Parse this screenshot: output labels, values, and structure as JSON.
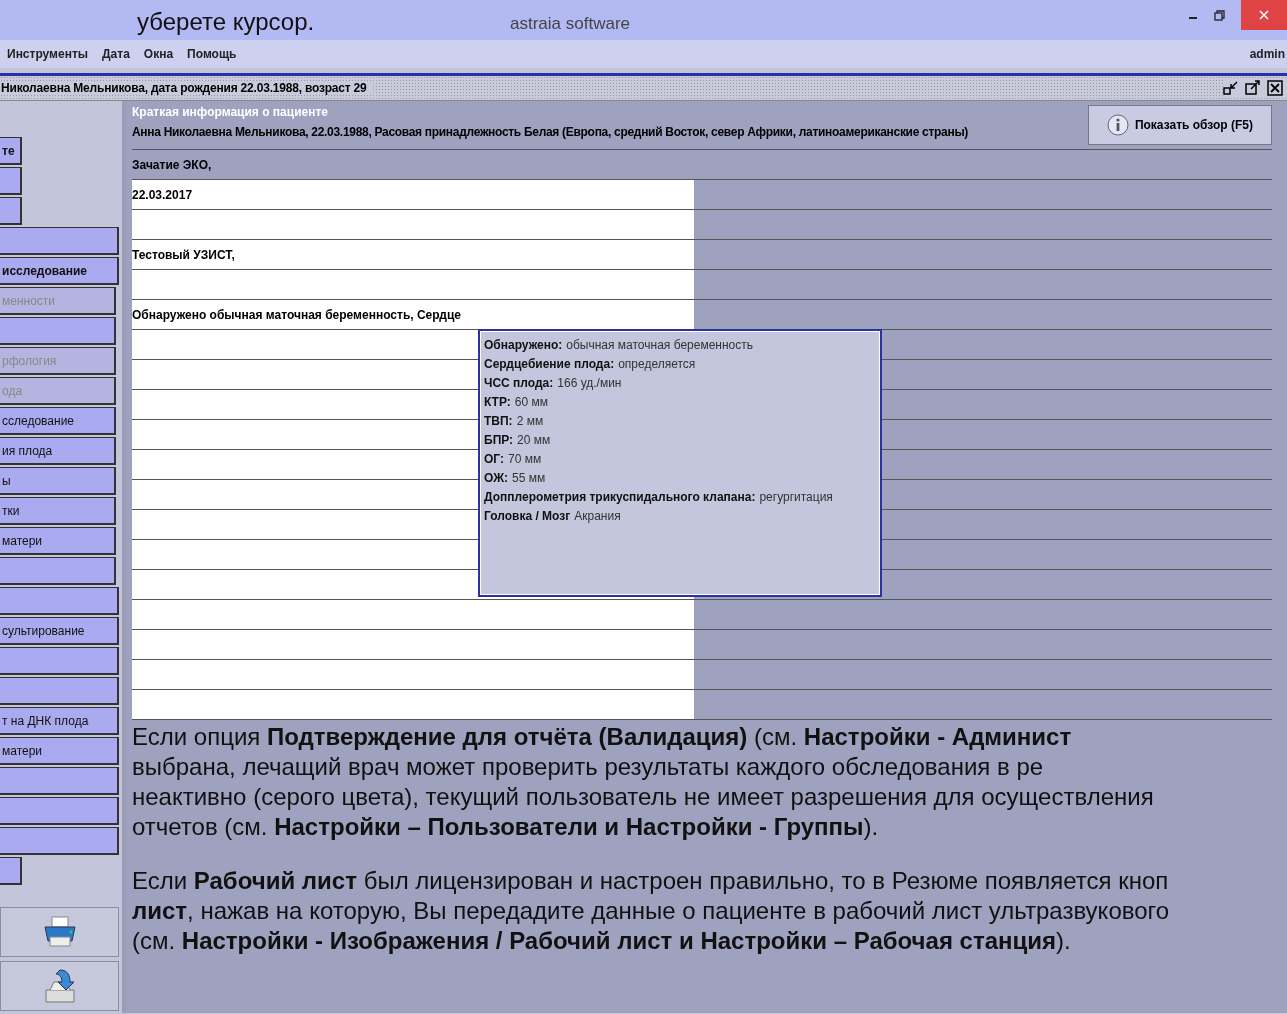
{
  "help_top": {
    "text": "уберете курсор."
  },
  "window": {
    "title": "astraia software"
  },
  "menu": [
    "Инструменты",
    "Дата",
    "Окна",
    "Помощь"
  ],
  "user": "admin",
  "patient_bar": {
    "title": "Николаевна Мельникова, дата рождения 22.03.1988, возраст 29"
  },
  "sidebar": {
    "groups": [
      {
        "items": [
          {
            "label": "те",
            "bold": true,
            "disabled": false
          },
          {
            "disabled": false
          },
          {
            "disabled": false
          }
        ]
      },
      {
        "items": [
          {
            "disabled": false
          },
          {
            "label": "исследование",
            "bold": true,
            "disabled": false
          }
        ]
      },
      {
        "items": [
          {
            "label": "менности",
            "bold": false,
            "disabled": true
          },
          {
            "disabled": false
          },
          {
            "label": "рфология",
            "bold": false,
            "disabled": true
          },
          {
            "label": "ода",
            "bold": false,
            "disabled": true
          },
          {
            "label": "сследование",
            "bold": false,
            "disabled": false
          },
          {
            "label": "ия плода",
            "bold": false,
            "disabled": false
          },
          {
            "label": "ы",
            "bold": false,
            "disabled": false
          },
          {
            "label": "тки",
            "bold": false,
            "disabled": false
          },
          {
            "label": "матери",
            "bold": false,
            "disabled": false
          },
          {
            "disabled": false
          }
        ]
      },
      {
        "items": [
          {
            "disabled": false
          },
          {
            "label": "сультирование",
            "bold": false,
            "disabled": false
          },
          {
            "disabled": false
          },
          {
            "disabled": false
          },
          {
            "label": "т на ДНК плода",
            "bold": false,
            "disabled": false
          },
          {
            "label": "матери",
            "bold": false,
            "disabled": false
          },
          {
            "disabled": false
          },
          {
            "disabled": false
          },
          {
            "disabled": false
          }
        ]
      },
      {
        "items": [
          {
            "disabled": false
          }
        ]
      }
    ]
  },
  "summary": {
    "caption": "Краткая информация о пациенте",
    "patient": "Анна Николаевна Мельникова, 22.03.1988, Расовая принадлежность Белая (Европа, средний Восток, север Африки, латиноамериканские страны)",
    "overview_button": "Показать обзор (F5)",
    "conception": "Зачатие ЭКО,",
    "entries": [
      {
        "text": "22.03.2017"
      },
      {
        "text": "Тестовый УЗИСТ,"
      },
      {
        "text": "Обнаружено обычная маточная беременность, Сердце"
      }
    ]
  },
  "tooltip": {
    "lines": [
      {
        "label": "Обнаружено:",
        "value": "обычная маточная беременность"
      },
      {
        "label": "Сердцебиение плода:",
        "value": "определяется"
      },
      {
        "label": "ЧСС плода:",
        "value": "166 уд./мин"
      },
      {
        "label": "КТР:",
        "value": "60 мм"
      },
      {
        "label": "ТВП:",
        "value": "2 мм"
      },
      {
        "label": "БПР:",
        "value": "20 мм"
      },
      {
        "label": "ОГ:",
        "value": "70 мм"
      },
      {
        "label": "ОЖ:",
        "value": "55 мм"
      },
      {
        "label": "Допплерометрия трикуспидального клапана:",
        "value": "регургитация"
      },
      {
        "label": "Головка / Мозг",
        "value": "Акрания"
      }
    ]
  },
  "help": {
    "paragraphs": [
      {
        "lines": [
          "Если опция **Подтверждение для отчёта (Валидация)** (см. **Настройки - Админист**",
          "выбрана, лечащий врач может проверить результаты каждого обследования в ре",
          "неактивно (серого цвета), текущий пользователь не имеет разрешения для осуществления",
          "отчетов (см. **Настройки – Пользователи и Настройки - Группы**)."
        ]
      },
      {
        "lines": [
          "Если **Рабочий лист** был лицензирован и настроен правильно, то в Резюме появляется кноп",
          "**лист**, нажав на которую, Вы передадите данные о пациенте в рабочий лист ультразвукового",
          "(см. **Настройки - Изображения / Рабочий лист и Настройки – Рабочая станция**)."
        ]
      }
    ]
  }
}
